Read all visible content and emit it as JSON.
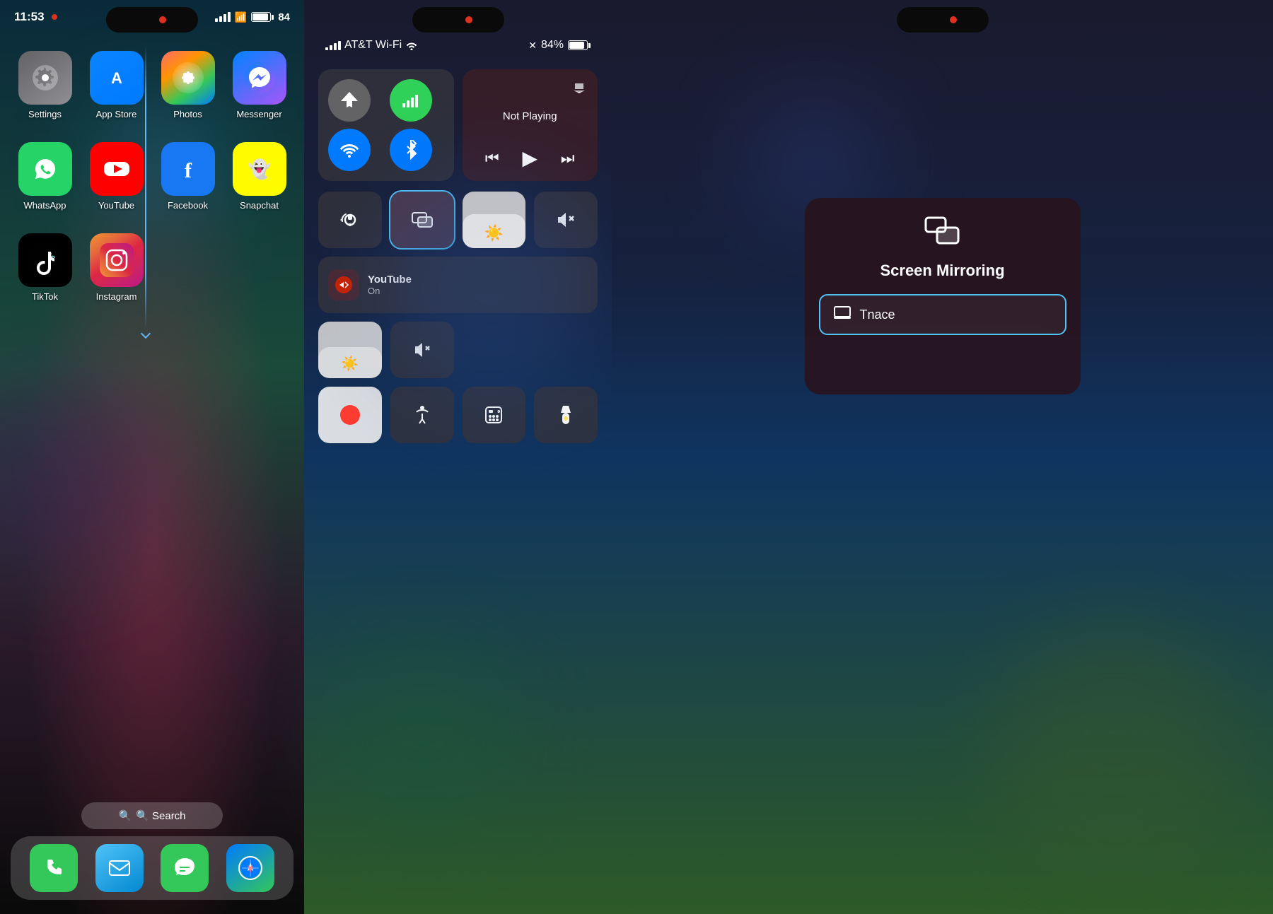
{
  "home": {
    "status": {
      "time": "11:53",
      "battery": "84",
      "search_placeholder": "Search"
    },
    "apps_row1": [
      {
        "id": "settings",
        "label": "Settings",
        "emoji": "⚙️",
        "style": "app-settings"
      },
      {
        "id": "appstore",
        "label": "App Store",
        "emoji": "🅰",
        "style": "app-appstore"
      },
      {
        "id": "photos",
        "label": "Photos",
        "emoji": "🖼",
        "style": "app-photos"
      },
      {
        "id": "messenger",
        "label": "Messenger",
        "emoji": "💬",
        "style": "app-messenger"
      }
    ],
    "apps_row2": [
      {
        "id": "whatsapp",
        "label": "WhatsApp",
        "emoji": "📱",
        "style": "app-whatsapp"
      },
      {
        "id": "youtube",
        "label": "YouTube",
        "emoji": "▶",
        "style": "app-youtube"
      },
      {
        "id": "facebook",
        "label": "Facebook",
        "emoji": "f",
        "style": "app-facebook"
      },
      {
        "id": "snapchat",
        "label": "Snapchat",
        "emoji": "👻",
        "style": "app-snapchat"
      }
    ],
    "apps_row3": [
      {
        "id": "tiktok",
        "label": "TikTok",
        "emoji": "♪",
        "style": "app-tiktok"
      },
      {
        "id": "instagram",
        "label": "Instagram",
        "emoji": "📷",
        "style": "app-instagram"
      }
    ],
    "dock": [
      {
        "id": "phone",
        "emoji": "📞",
        "style": "dock-phone"
      },
      {
        "id": "mail",
        "emoji": "✉️",
        "style": "dock-mail"
      },
      {
        "id": "messages",
        "emoji": "💬",
        "style": "dock-messages"
      },
      {
        "id": "safari",
        "emoji": "🧭",
        "style": "dock-safari"
      }
    ],
    "search_label": "🔍 Search"
  },
  "control_center": {
    "carrier": "AT&T Wi-Fi",
    "battery_pct": "84%",
    "now_playing": {
      "label": "Not Playing",
      "airplay_icon": "airplay"
    },
    "youtube": {
      "title": "YouTube",
      "subtitle": "On"
    },
    "buttons": {
      "airplane": "✈",
      "cellular": "📶",
      "wifi": "wifi",
      "bluetooth": "bluetooth",
      "screen_mirror": "screen-mirror",
      "lock_rotation": "lock-rotation",
      "brightness": "☀",
      "mute": "mute",
      "screen_record": "record",
      "accessibility": "accessibility",
      "calculator": "calc",
      "flashlight": "flashlight"
    }
  },
  "screen_mirroring": {
    "title": "Screen Mirroring",
    "device": "Tnace",
    "icon": "screen-mirror"
  }
}
